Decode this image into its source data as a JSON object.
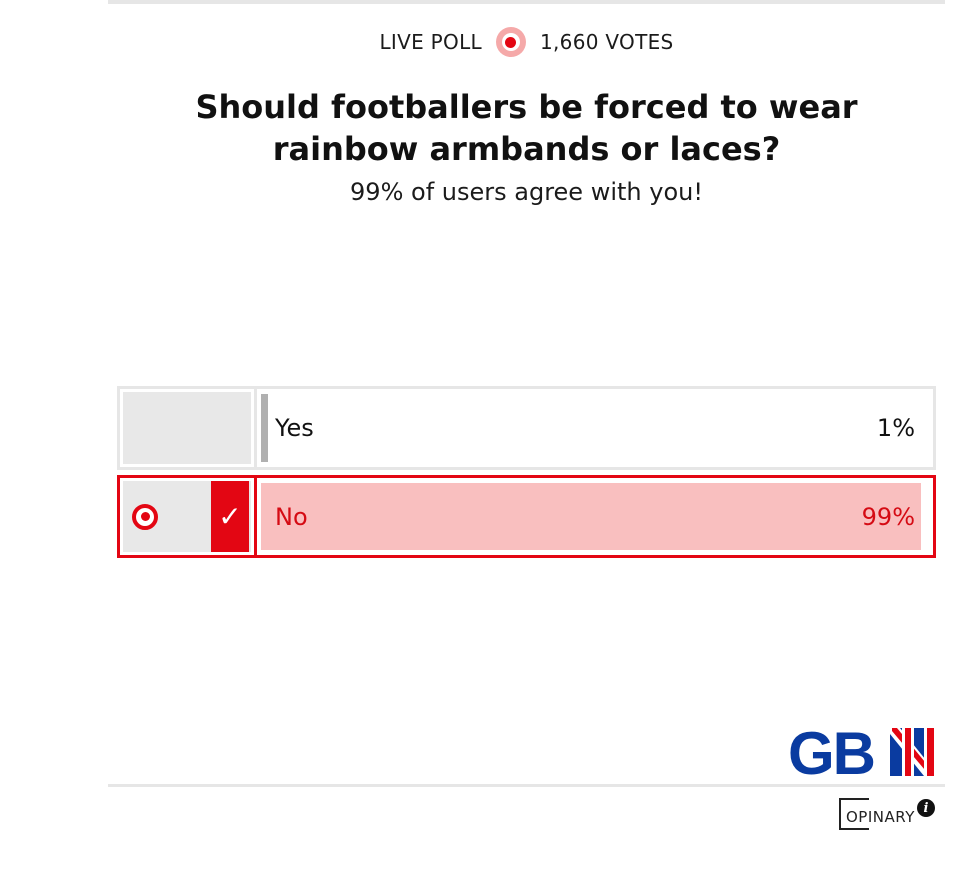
{
  "poll": {
    "live_label": "LIVE POLL",
    "votes_label": "1,660 VOTES",
    "question": "Should footballers be forced to wear rainbow armbands or laces?",
    "agree_text": "99% of users agree with you!"
  },
  "options": [
    {
      "label": "Yes",
      "percent_text": "1%",
      "percent": 1,
      "selected": false
    },
    {
      "label": "No",
      "percent_text": "99%",
      "percent": 99,
      "selected": true
    }
  ],
  "branding": {
    "logo_text": "GBN",
    "footer_brand": "OPINARY",
    "info_label": "i"
  },
  "colors": {
    "accent": "#e30613",
    "selected_fill": "#f9bfbf",
    "logo_blue": "#0a3ba0"
  }
}
